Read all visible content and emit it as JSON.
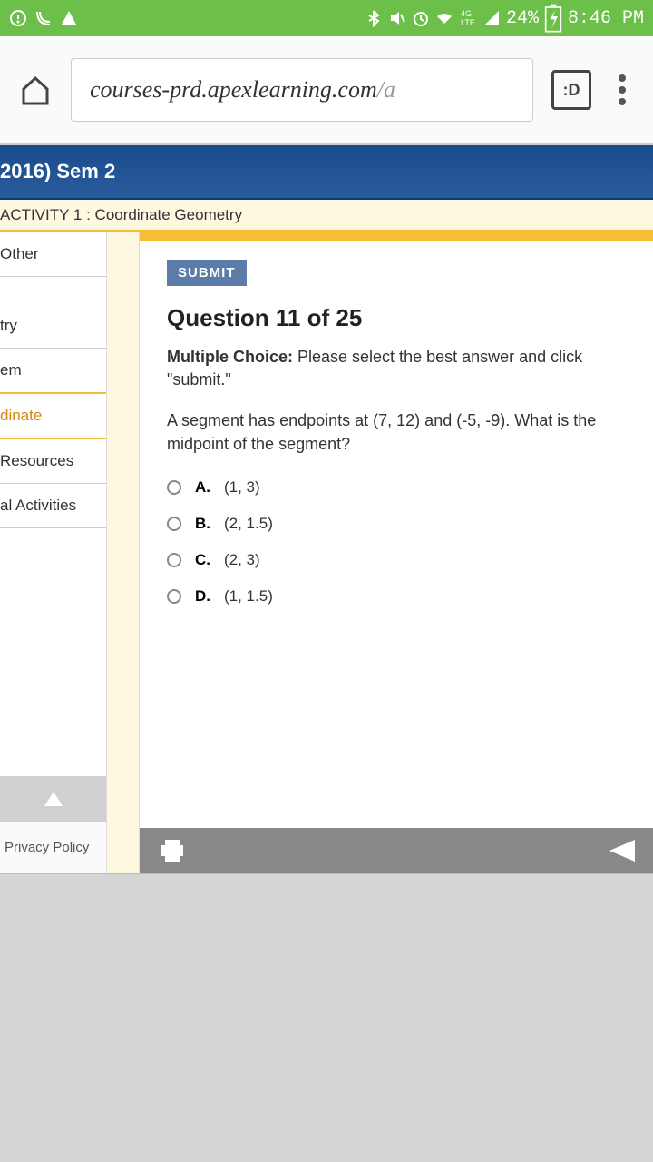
{
  "status": {
    "battery": "24%",
    "time": "8:46 PM"
  },
  "browser": {
    "url_main": "courses-prd.apexlearning.com",
    "url_path": "/a",
    "tab_indicator": ":D"
  },
  "course": {
    "header": "2016) Sem 2",
    "activity": "ACTIVITY 1 : Coordinate Geometry"
  },
  "sidebar": {
    "items": [
      {
        "label": "Other"
      },
      {
        "label": "try"
      },
      {
        "label": "em"
      },
      {
        "label": "dinate"
      },
      {
        "label": "Resources"
      },
      {
        "label": "al Activities"
      }
    ],
    "privacy": "Privacy Policy"
  },
  "quiz": {
    "submit_label": "SUBMIT",
    "question_number": "Question 11 of 25",
    "type_label": "Multiple Choice:",
    "type_text": " Please select the best answer and click \"submit.\"",
    "question": "A segment has endpoints at (7, 12) and (-5, -9). What is the midpoint of the segment?",
    "answers": [
      {
        "letter": "A.",
        "text": "(1, 3)"
      },
      {
        "letter": "B.",
        "text": "(2, 1.5)"
      },
      {
        "letter": "C.",
        "text": "(2, 3)"
      },
      {
        "letter": "D.",
        "text": "(1, 1.5)"
      }
    ]
  }
}
